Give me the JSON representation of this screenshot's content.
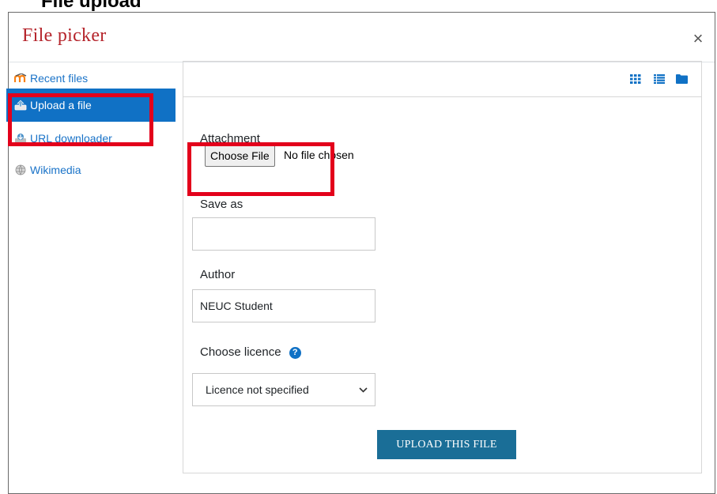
{
  "top_crop_text": "File upload",
  "dialog": {
    "title": "File picker",
    "close_label": "×"
  },
  "sidebar": {
    "items": [
      {
        "label": "Recent files",
        "icon": "moodle-logo-icon"
      },
      {
        "label": "Upload a file",
        "icon": "upload-icon",
        "active": true
      },
      {
        "label": "URL downloader",
        "icon": "url-downloader-icon"
      },
      {
        "label": "Wikimedia",
        "icon": "wikimedia-icon"
      }
    ]
  },
  "toolbar": {
    "views": [
      "grid-view-icon",
      "list-view-icon",
      "folder-view-icon"
    ]
  },
  "form": {
    "attachment_label": "Attachment",
    "choose_file_label": "Choose File",
    "no_file_text": "No file chosen",
    "save_as_label": "Save as",
    "save_as_value": "",
    "author_label": "Author",
    "author_value": "NEUC Student",
    "licence_label": "Choose licence",
    "licence_value": "Licence not specified",
    "upload_button": "UPLOAD THIS FILE"
  },
  "colors": {
    "title_red": "#b5242b",
    "active_blue": "#1071c5",
    "link_blue": "#1a73c8",
    "upload_btn": "#1a6e97",
    "highlight_red": "#e3001b"
  }
}
